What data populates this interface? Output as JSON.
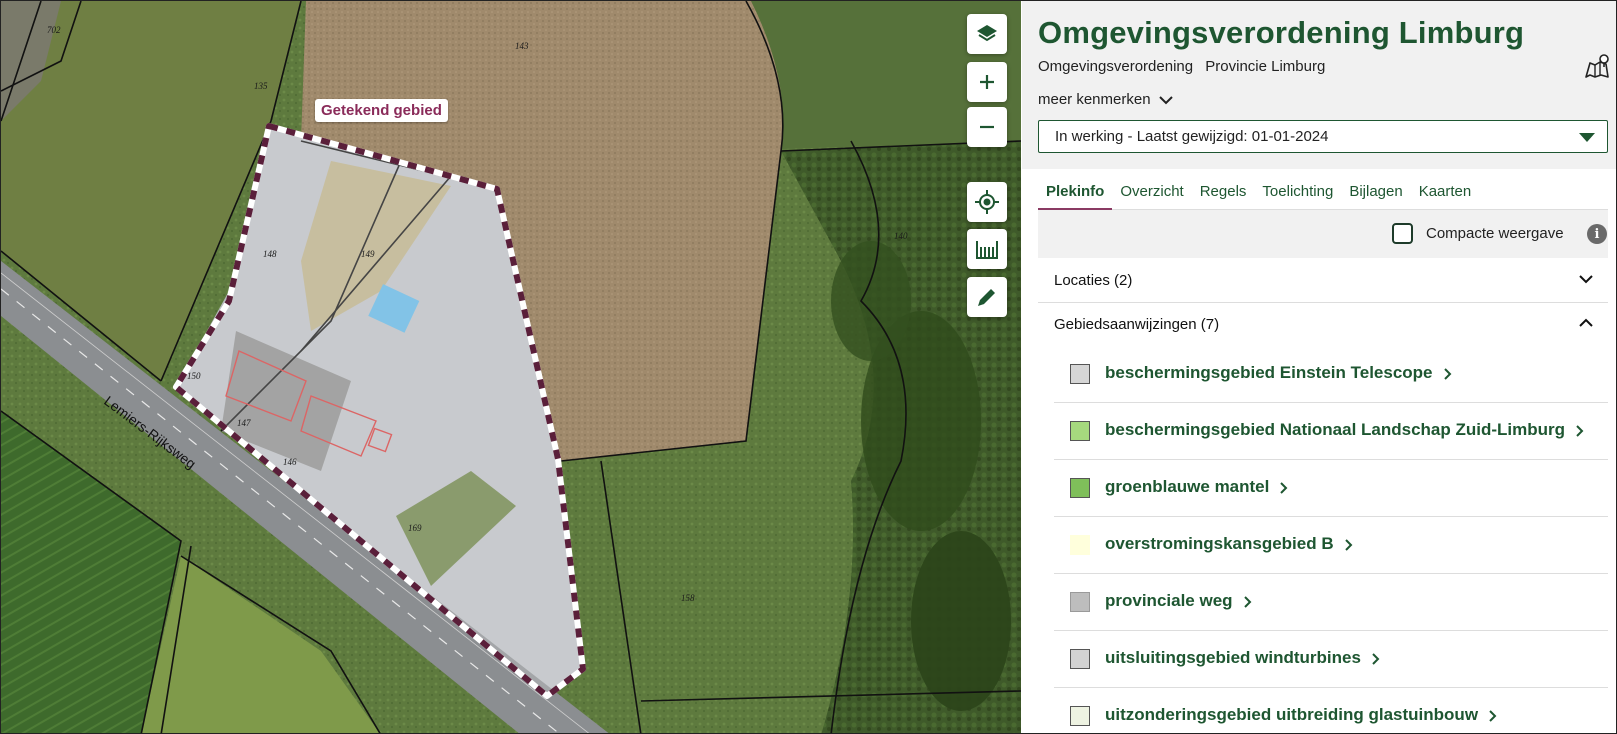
{
  "map": {
    "drawn_area_label": "Getekend gebied",
    "road_label": "Lemiers-Rijksweg",
    "parcel_numbers": [
      "702",
      "143",
      "135",
      "148",
      "149",
      "150",
      "147",
      "146",
      "169",
      "140",
      "158"
    ],
    "buttons": [
      "layers-icon",
      "zoom-in-icon",
      "zoom-out-icon",
      "locate-icon",
      "measure-icon",
      "draw-icon"
    ]
  },
  "header": {
    "title": "Omgevingsverordening Limburg",
    "subtitle_type": "Omgevingsverordening",
    "subtitle_authority": "Provincie Limburg",
    "more_label": "meer kenmerken",
    "version_select": "In werking - Laatst gewijzigd: 01-01-2024"
  },
  "tabs": [
    {
      "label": "Plekinfo",
      "active": true
    },
    {
      "label": "Overzicht",
      "active": false
    },
    {
      "label": "Regels",
      "active": false
    },
    {
      "label": "Toelichting",
      "active": false
    },
    {
      "label": "Bijlagen",
      "active": false
    },
    {
      "label": "Kaarten",
      "active": false
    }
  ],
  "compact": {
    "label": "Compacte weergave",
    "checked": false
  },
  "sections": {
    "locaties": "Locaties (2)",
    "gebiedsaanwijzingen": "Gebiedsaanwijzingen (7)"
  },
  "items": [
    {
      "label": "beschermingsgebied Einstein Telescope",
      "color": "#d6d6d6"
    },
    {
      "label": "beschermingsgebied Nationaal Landschap Zuid-Limburg",
      "color": "#a6d97e"
    },
    {
      "label": "groenblauwe mantel",
      "color": "#7fbf5a"
    },
    {
      "label": "overstromingskansgebied B",
      "color": "#ffffdc"
    },
    {
      "label": "provinciale weg",
      "color": "#bdbdbd"
    },
    {
      "label": "uitsluitingsgebied windturbines",
      "color": "#d2d2d2"
    },
    {
      "label": "uitzonderingsgebied uitbreiding glastuinbouw",
      "color": "#eef3e2"
    }
  ],
  "colors": {
    "brand": "#1e5631",
    "accent": "#8a3a63"
  }
}
